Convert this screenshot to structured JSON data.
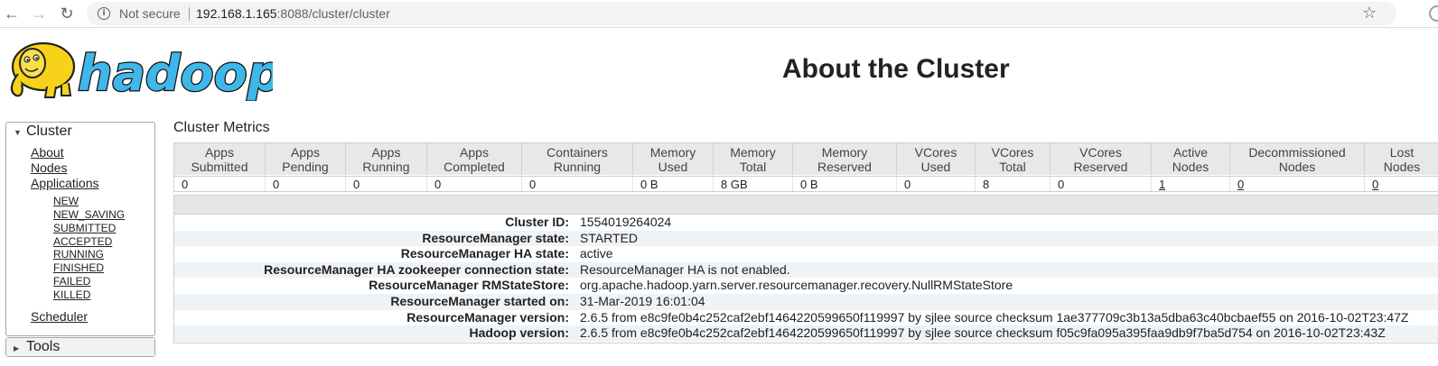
{
  "browser": {
    "security_label": "Not secure",
    "url_host": "192.168.1.165",
    "url_rest": ":8088/cluster/cluster"
  },
  "header": {
    "logo_text": "hadoop",
    "title": "About the Cluster"
  },
  "sidebar": {
    "cluster_label": "Cluster",
    "links": [
      "About",
      "Nodes",
      "Applications"
    ],
    "app_states": [
      "NEW",
      "NEW_SAVING",
      "SUBMITTED",
      "ACCEPTED",
      "RUNNING",
      "FINISHED",
      "FAILED",
      "KILLED"
    ],
    "scheduler_label": "Scheduler",
    "tools_label": "Tools"
  },
  "metrics": {
    "title": "Cluster Metrics",
    "headers": [
      "Apps\nSubmitted",
      "Apps\nPending",
      "Apps\nRunning",
      "Apps\nCompleted",
      "Containers\nRunning",
      "Memory\nUsed",
      "Memory\nTotal",
      "Memory\nReserved",
      "VCores\nUsed",
      "VCores\nTotal",
      "VCores\nReserved",
      "Active\nNodes",
      "Decommissioned\nNodes",
      "Lost\nNodes"
    ],
    "values": [
      "0",
      "0",
      "0",
      "0",
      "0",
      "0 B",
      "8 GB",
      "0 B",
      "0",
      "8",
      "0",
      "1",
      "0",
      "0"
    ]
  },
  "cluster_info": [
    {
      "label": "Cluster ID:",
      "value": "1554019264024"
    },
    {
      "label": "ResourceManager state:",
      "value": "STARTED"
    },
    {
      "label": "ResourceManager HA state:",
      "value": "active"
    },
    {
      "label": "ResourceManager HA zookeeper connection state:",
      "value": "ResourceManager HA is not enabled."
    },
    {
      "label": "ResourceManager RMStateStore:",
      "value": "org.apache.hadoop.yarn.server.resourcemanager.recovery.NullRMStateStore"
    },
    {
      "label": "ResourceManager started on:",
      "value": "31-Mar-2019 16:01:04"
    },
    {
      "label": "ResourceManager version:",
      "value": "2.6.5 from e8c9fe0b4c252caf2ebf1464220599650f119997 by sjlee source checksum 1ae377709c3b13a5dba63c40bcbaef55 on 2016-10-02T23:47Z"
    },
    {
      "label": "Hadoop version:",
      "value": "2.6.5 from e8c9fe0b4c252caf2ebf1464220599650f119997 by sjlee source checksum f05c9fa095a395faa9db9f7ba5d754 on 2016-10-02T23:43Z"
    }
  ]
}
